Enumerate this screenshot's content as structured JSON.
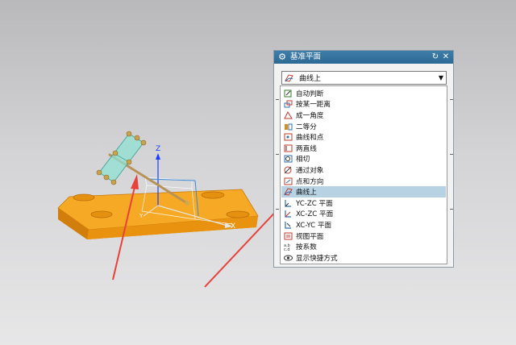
{
  "dialog": {
    "title": "基准平面",
    "gear_icon": "gear-icon",
    "reset_glyph": "↻",
    "close_glyph": "✕",
    "dropdown_arrow": "▼",
    "selected_type": "曲线上",
    "types": [
      {
        "label": "自动判断",
        "icon": "auto-infer-icon",
        "color": "#3a7a2a"
      },
      {
        "label": "按某一距离",
        "icon": "distance-icon",
        "color": "#2f6fb0"
      },
      {
        "label": "成一角度",
        "icon": "angle-icon",
        "color": "#c0392b"
      },
      {
        "label": "二等分",
        "icon": "bisector-icon",
        "color": "#e08a1e"
      },
      {
        "label": "曲线和点",
        "icon": "curve-point-icon",
        "color": "#c0392b"
      },
      {
        "label": "两直线",
        "icon": "two-lines-icon",
        "color": "#c0392b"
      },
      {
        "label": "相切",
        "icon": "tangent-icon",
        "color": "#2f6fb0"
      },
      {
        "label": "通过对象",
        "icon": "through-object-icon",
        "color": "#c0392b"
      },
      {
        "label": "点和方向",
        "icon": "point-direction-icon",
        "color": "#c0392b"
      },
      {
        "label": "曲线上",
        "icon": "on-curve-icon",
        "color": "#c0392b",
        "selected": true
      },
      {
        "label": "YC-ZC 平面",
        "icon": "yc-zc-plane-icon",
        "color": "#2f6fb0"
      },
      {
        "label": "XC-ZC 平面",
        "icon": "xc-zc-plane-icon",
        "color": "#2f6fb0"
      },
      {
        "label": "XC-YC 平面",
        "icon": "xc-yc-plane-icon",
        "color": "#2f6fb0"
      },
      {
        "label": "视图平面",
        "icon": "view-plane-icon",
        "color": "#c0392b"
      },
      {
        "label": "按系数",
        "icon": "coefficients-icon",
        "color": "#333333"
      },
      {
        "label": "显示快捷方式",
        "icon": "eye-icon",
        "color": "#333333"
      }
    ]
  },
  "viewport": {
    "axis_z": "Z",
    "axis_x": "X",
    "axis_y": "Y",
    "part_color": "#f4a21c",
    "plane_color": "#7fd3c8",
    "arrow_color": "#e8413a"
  },
  "colors": {
    "titlebar": "#2f6e99",
    "selection": "#b7d3e3"
  }
}
